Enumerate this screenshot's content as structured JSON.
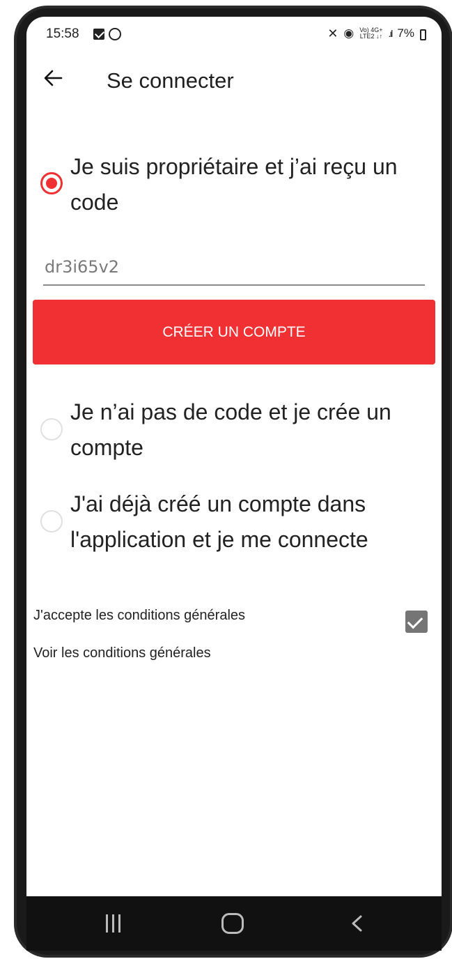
{
  "status_bar": {
    "time": "15:58",
    "battery": "7%",
    "network_top": "Vo) 4G+",
    "network_bottom": "LTE2 ↓↑"
  },
  "app_bar": {
    "title": "Se connecter"
  },
  "options": [
    {
      "label": "Je suis propriétaire et j’ai reçu un code",
      "selected": true
    },
    {
      "label": "Je n’ai pas de code et je crée un compte",
      "selected": false
    },
    {
      "label": "J'ai déjà créé un compte dans l'application et je me connecte",
      "selected": false
    }
  ],
  "code_field": {
    "value": "dr3i65v2"
  },
  "create_button": {
    "label": "CRÉER UN COMPTE"
  },
  "terms": {
    "accept_label": "J'accepte les conditions générales",
    "accepted": true,
    "view_label": "Voir les conditions générales"
  },
  "colors": {
    "accent": "#f03032",
    "checkbox": "#757575",
    "nav_bar": "#111111"
  },
  "icons": {
    "back": "arrow-left-icon",
    "nav_recent": "recent-apps-icon",
    "nav_home": "home-icon",
    "nav_back": "chevron-left-icon"
  }
}
